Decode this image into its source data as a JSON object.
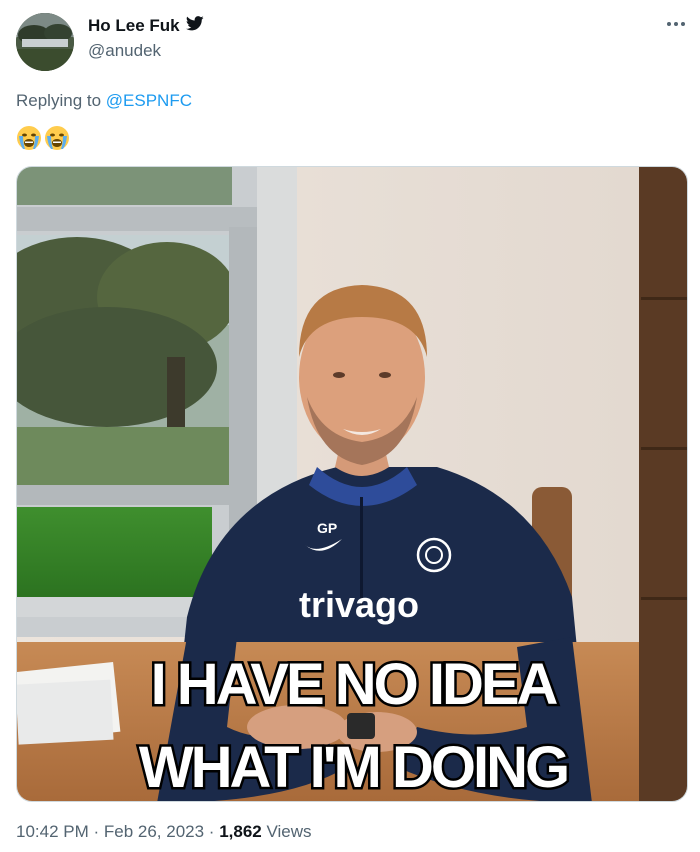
{
  "author": {
    "display_name": "Ho Lee Fuk",
    "handle": "@anudek",
    "verified_icon": "twitter-bird-icon"
  },
  "more_icon": "more-horizontal-icon",
  "reply": {
    "prefix": "Replying to ",
    "target": "@ESPNFC"
  },
  "emojis": [
    "loudly-crying-face",
    "loudly-crying-face"
  ],
  "media": {
    "caption_line1": "I HAVE NO IDEA",
    "caption_line2": "WHAT I'M DOING",
    "shirt_sponsor": "trivago",
    "shirt_initials": "GP"
  },
  "meta": {
    "time": "10:42 PM",
    "separator": " · ",
    "date": "Feb 26, 2023",
    "views_count": "1,862",
    "views_label": " Views"
  },
  "colors": {
    "accent": "#1d9bf0",
    "secondary_text": "#536471",
    "primary_text": "#0f1419"
  }
}
